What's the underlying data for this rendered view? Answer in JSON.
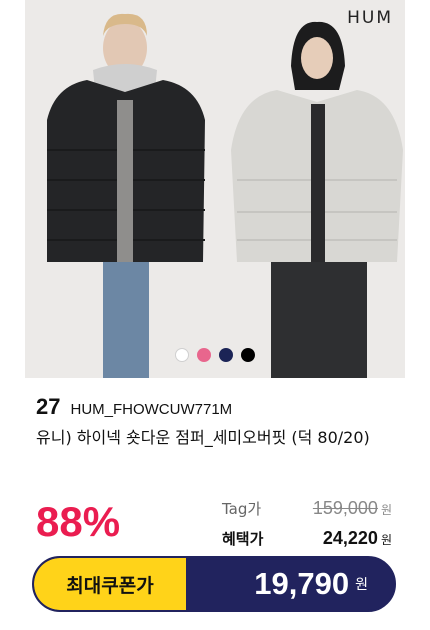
{
  "brand": "HUM",
  "image": {
    "background": "#eceae8",
    "swatches": [
      "#ffffff",
      "#e8668d",
      "#1b2456",
      "#000000"
    ]
  },
  "product": {
    "rank": "27",
    "code": "HUM_FHOWCUW771M",
    "name": "유니) 하이넥 숏다운 점퍼_세미오버핏 (덕 80/20)"
  },
  "pricing": {
    "discount": "88%",
    "tag_label": "Tag가",
    "tag_price": "159,000",
    "benefit_label": "혜택가",
    "benefit_price": "24,220",
    "currency": "원",
    "accent_color": "#ea1d50"
  },
  "coupon": {
    "label": "최대쿠폰가",
    "price": "19,790",
    "currency": "원",
    "label_bg": "#ffd319",
    "bar_bg": "#21235e"
  }
}
